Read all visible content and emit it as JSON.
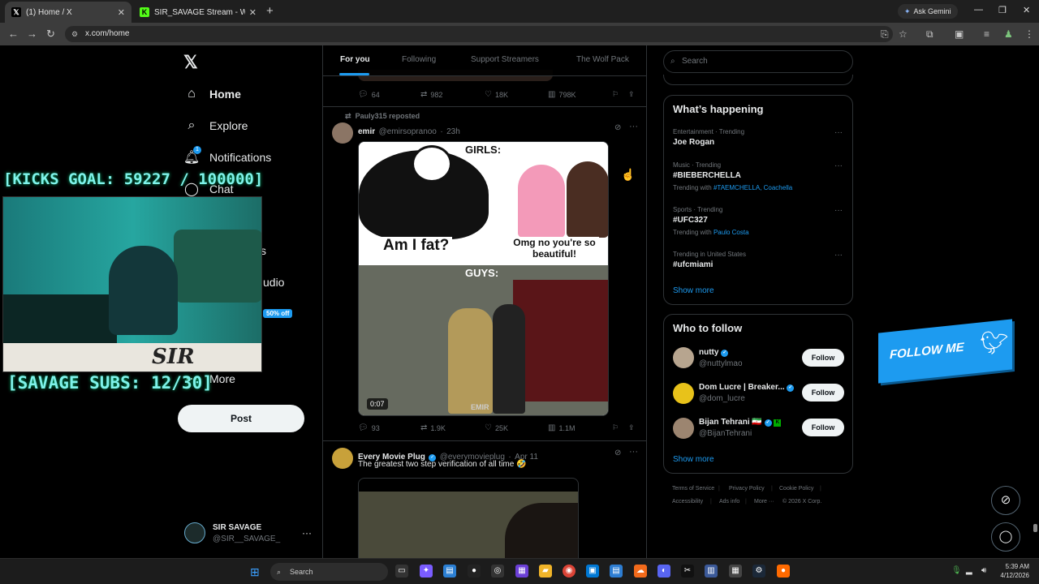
{
  "browser": {
    "tabs": [
      {
        "label": "(1) Home / X",
        "active": true
      },
      {
        "label": "SIR_SAVAGE Stream - Watch Liv",
        "active": false
      }
    ],
    "ask_gemini": "Ask Gemini",
    "url": "x.com/home"
  },
  "sidebar": {
    "items": [
      {
        "label": "Home",
        "icon": "home-icon"
      },
      {
        "label": "Explore",
        "icon": "search-icon"
      },
      {
        "label": "Notifications",
        "icon": "bell-icon",
        "badge": "1"
      },
      {
        "label": "Chat",
        "icon": "chat-icon"
      },
      {
        "label": "s",
        "icon": "list-icon"
      },
      {
        "label": "udio",
        "icon": "studio-icon"
      },
      {
        "label": "More",
        "icon": "more-circle-icon"
      }
    ],
    "post_label": "Post",
    "profile": {
      "name": "SIR SAVAGE",
      "handle": "@SIR__SAVAGE_"
    }
  },
  "feed_tabs": [
    "For you",
    "Following",
    "Support Streamers",
    "The Wolf Pack"
  ],
  "top_tweet_actions": {
    "replies": "64",
    "reposts": "982",
    "likes": "18K",
    "views": "798K"
  },
  "tweet1": {
    "repost_by": "Pauly315 reposted",
    "name": "emir",
    "handle": "@emirsopranoo",
    "time": "23h",
    "meme": {
      "girls": "GIRLS:",
      "fat": "Am I fat?",
      "omg": "Omg no you're so beautiful!",
      "guys": "GUYS:",
      "watermark": "EMIR"
    },
    "duration": "0:07",
    "replies": "93",
    "reposts": "1.9K",
    "likes": "25K",
    "views": "1.1M"
  },
  "tweet2": {
    "name": "Every Movie Plug",
    "handle": "@everymovieplug",
    "time": "Apr 11",
    "text": "The greatest two step verification of all time 🤣"
  },
  "right": {
    "search_placeholder": "Search",
    "happening_title": "What’s happening",
    "trends": [
      {
        "category": "Entertainment · Trending",
        "name": "Joe Rogan",
        "with": "",
        "links": ""
      },
      {
        "category": "Music · Trending",
        "name": "#BIEBERCHELLA",
        "with": "Trending with",
        "links": "#TAEMCHELLA, Coachella"
      },
      {
        "category": "Sports · Trending",
        "name": "#UFC327",
        "with": "Trending with",
        "links": "Paulo Costa"
      },
      {
        "category": "Trending in United States",
        "name": "#ufcmiami",
        "with": "",
        "links": ""
      }
    ],
    "show_more": "Show more",
    "wtf_title": "Who to follow",
    "who_to_follow": [
      {
        "name": "nutty",
        "handle": "@nuttylmao",
        "follow": "Follow"
      },
      {
        "name": "Dom Lucre | Breaker...",
        "handle": "@dom_lucre",
        "follow": "Follow"
      },
      {
        "name": "Bijan Tehrani 🇮🇷",
        "handle": "@BijanTehrani",
        "follow": "Follow"
      }
    ],
    "footer": [
      "Terms of Service",
      "Privacy Policy",
      "Cookie Policy",
      "Accessibility",
      "Ads info",
      "More ···",
      "© 2026 X Corp."
    ]
  },
  "overlay": {
    "kicks_goal": "[KICKS GOAL: 59227 / 100000]",
    "subs_goal": "[SAVAGE SUBS: 12/30]",
    "cam_brand": "SIR SAVAGE",
    "discount": "50% off",
    "follow_me": "FOLLOW ME"
  },
  "taskbar": {
    "search_label": "Search",
    "time": "5:39 AM",
    "date": "4/12/2026"
  },
  "colors": {
    "accent": "#1d9bf0",
    "background": "#000000",
    "overlay_text": "#7ff2ea"
  }
}
